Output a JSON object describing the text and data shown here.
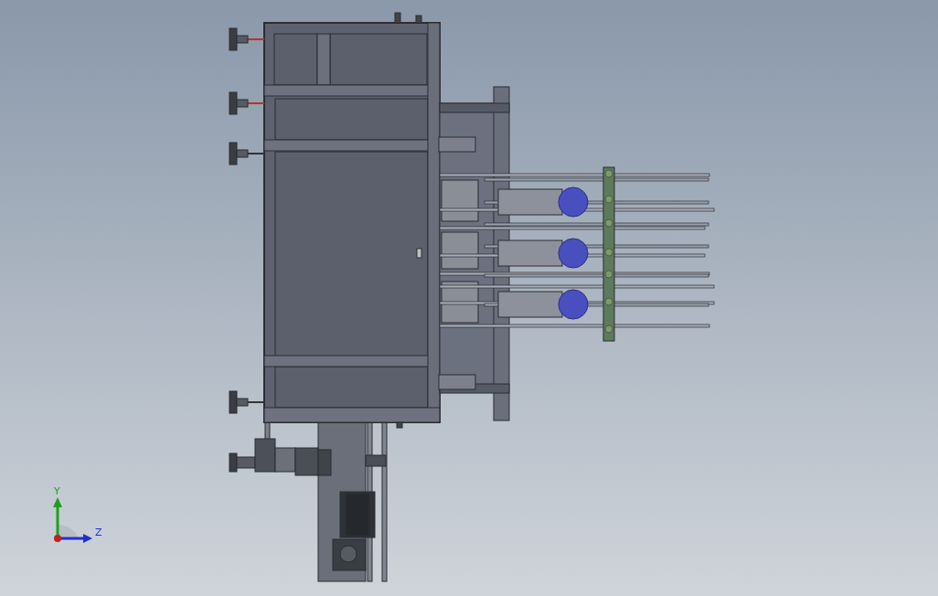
{
  "viewport": {
    "triad": {
      "axes": [
        {
          "label": "Y",
          "kind": "vertical",
          "color": "#1fa01f"
        },
        {
          "label": "Z",
          "kind": "horizontal",
          "color": "#2030d0"
        }
      ]
    }
  }
}
